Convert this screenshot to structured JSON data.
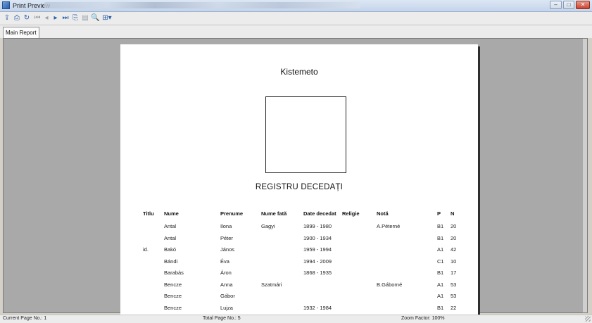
{
  "window": {
    "title": "Print Preview"
  },
  "tabs": [
    {
      "label": "Main Report"
    }
  ],
  "report": {
    "title": "Kistemeto",
    "subtitle": "REGISTRU DECEDAȚI",
    "columns": [
      "Titlu",
      "Nume",
      "Prenume",
      "Nume fată",
      "Date decedat",
      "Religie",
      "Notă",
      "P",
      "N"
    ],
    "rows": [
      [
        "",
        "Antal",
        "Ilona",
        "Gagyi",
        "1899 - 1980",
        "",
        "A.Péterné",
        "B1",
        "20"
      ],
      [
        "",
        "Antal",
        "Péter",
        "",
        "1900 - 1934",
        "",
        "",
        "B1",
        "20"
      ],
      [
        "id.",
        "Bakó",
        "János",
        "",
        "1959 - 1994",
        "",
        "",
        "A1",
        "42"
      ],
      [
        "",
        "Bándi",
        "Éva",
        "",
        "1994 - 2009",
        "",
        "",
        "C1",
        "10"
      ],
      [
        "",
        "Barabás",
        "Áron",
        "",
        "1868 - 1935",
        "",
        "",
        "B1",
        "17"
      ],
      [
        "",
        "Bencze",
        "Anna",
        "Szatmári",
        "",
        "",
        "B.Gáborné",
        "A1",
        "53"
      ],
      [
        "",
        "Bencze",
        "Gábor",
        "",
        "",
        "",
        "",
        "A1",
        "53"
      ],
      [
        "",
        "Bencze",
        "Lujza",
        "",
        "1932 - 1984",
        "",
        "",
        "B1",
        "22"
      ]
    ]
  },
  "status": {
    "current_page": "Current Page No.: 1",
    "total_pages": "Total Page No.: 5",
    "zoom": "Zoom Factor: 100%"
  }
}
